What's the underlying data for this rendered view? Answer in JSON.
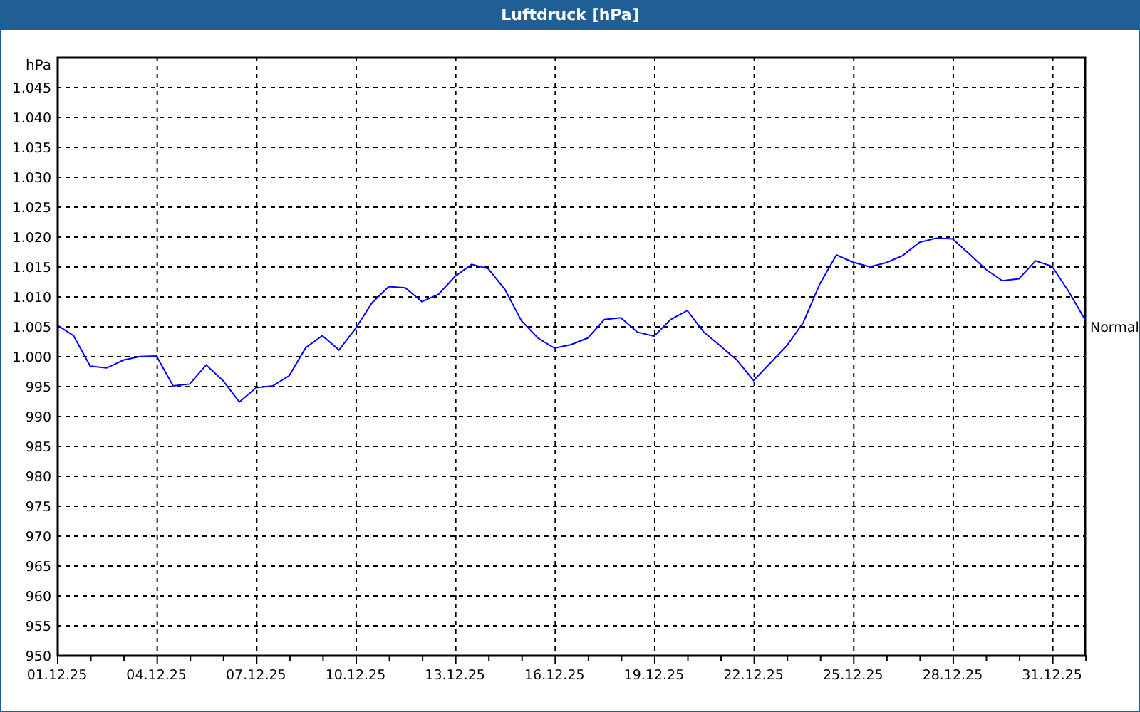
{
  "window": {
    "title": "Luftdruck [hPa]"
  },
  "chart": {
    "chart_data": {
      "type": "line",
      "grid": true,
      "ylabel": "hPa",
      "ylim": [
        950,
        1050
      ],
      "yticks": [
        {
          "value": 950,
          "label": "950"
        },
        {
          "value": 955,
          "label": "955"
        },
        {
          "value": 960,
          "label": "960"
        },
        {
          "value": 965,
          "label": "965"
        },
        {
          "value": 970,
          "label": "970"
        },
        {
          "value": 975,
          "label": "975"
        },
        {
          "value": 980,
          "label": "980"
        },
        {
          "value": 985,
          "label": "985"
        },
        {
          "value": 990,
          "label": "990"
        },
        {
          "value": 995,
          "label": "995"
        },
        {
          "value": 1000,
          "label": "1.000"
        },
        {
          "value": 1005,
          "label": "1.005"
        },
        {
          "value": 1010,
          "label": "1.010"
        },
        {
          "value": 1015,
          "label": "1.015"
        },
        {
          "value": 1020,
          "label": "1.020"
        },
        {
          "value": 1025,
          "label": "1.025"
        },
        {
          "value": 1030,
          "label": "1.030"
        },
        {
          "value": 1035,
          "label": "1.035"
        },
        {
          "value": 1040,
          "label": "1.040"
        },
        {
          "value": 1045,
          "label": "1.045"
        }
      ],
      "categories": [
        "01.12.25",
        null,
        null,
        null,
        null,
        null,
        "04.12.25",
        null,
        null,
        null,
        null,
        null,
        "07.12.25",
        null,
        null,
        null,
        null,
        null,
        "10.12.25",
        null,
        null,
        null,
        null,
        null,
        "13.12.25",
        null,
        null,
        null,
        null,
        null,
        "16.12.25",
        null,
        null,
        null,
        null,
        null,
        "19.12.25",
        null,
        null,
        null,
        null,
        null,
        "22.12.25",
        null,
        null,
        null,
        null,
        null,
        "25.12.25",
        null,
        null,
        null,
        null,
        null,
        "28.12.25",
        null,
        null,
        null,
        null,
        null,
        "31.12.25",
        null,
        null
      ],
      "series": [
        {
          "name": "Normal",
          "color": "#0000ff",
          "values": [
            1005.2,
            1003.4,
            998.3,
            998,
            999.3,
            999.9,
            1000,
            995,
            995.3,
            998.5,
            995.9,
            992.3,
            994.7,
            995,
            996.7,
            1001.4,
            1003.4,
            1001,
            1004.6,
            1008.9,
            1011.6,
            1011.4,
            1009.1,
            1010.3,
            1013.3,
            1015.3,
            1014.6,
            1011.2,
            1005.9,
            1003,
            1001.3,
            1001.9,
            1003,
            1006.1,
            1006.4,
            1004,
            1003.3,
            1006.1,
            1007.6,
            1004,
            1001.7,
            999.3,
            995.9,
            998.8,
            1001.7,
            1005.6,
            1012.1,
            1016.9,
            1015.7,
            1014.9,
            1015.6,
            1016.8,
            1019,
            1019.7,
            1019.6,
            1017.1,
            1014.5,
            1012.6,
            1012.9,
            1015.9,
            1015,
            1010.8,
            1006
          ]
        }
      ]
    }
  }
}
